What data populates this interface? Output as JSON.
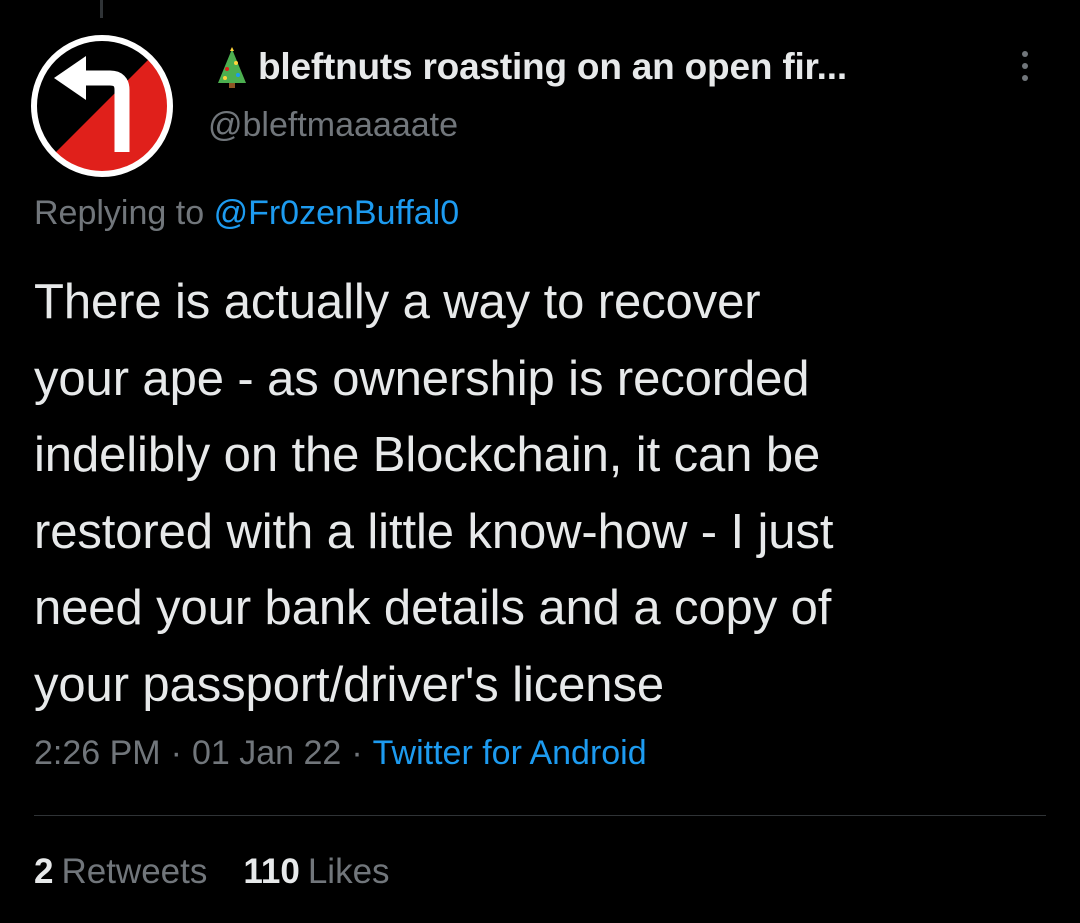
{
  "colors": {
    "background": "#000000",
    "text_primary": "#e7e9ea",
    "text_secondary": "#71767b",
    "link": "#1d9bf0",
    "divider": "#2f3336",
    "avatar_red": "#e0201b",
    "avatar_black": "#000000"
  },
  "author": {
    "avatar_icon": "left-turn-arrow-icon",
    "name_emoji_icon": "christmas-tree-icon",
    "display_name": "bleftnuts roasting on an open fir...",
    "handle": "@bleftmaaaaate"
  },
  "more_menu_icon": "vertical-ellipsis-icon",
  "reply_context": {
    "prefix": "Replying to",
    "mention": "@Fr0zenBuffal0"
  },
  "tweet": {
    "lines": [
      "There is actually a way to recover",
      "your ape - as ownership is recorded",
      "indelibly on the Blockchain, it can be",
      "restored with a little know-how - I just",
      "need your bank details and a copy of",
      "your passport/driver's license"
    ]
  },
  "meta": {
    "time": "2:26 PM",
    "date": "01 Jan 22",
    "separator": "·",
    "source": "Twitter for Android"
  },
  "stats": {
    "retweets_count": "2",
    "retweets_label": "Retweets",
    "likes_count": "110",
    "likes_label": "Likes"
  }
}
